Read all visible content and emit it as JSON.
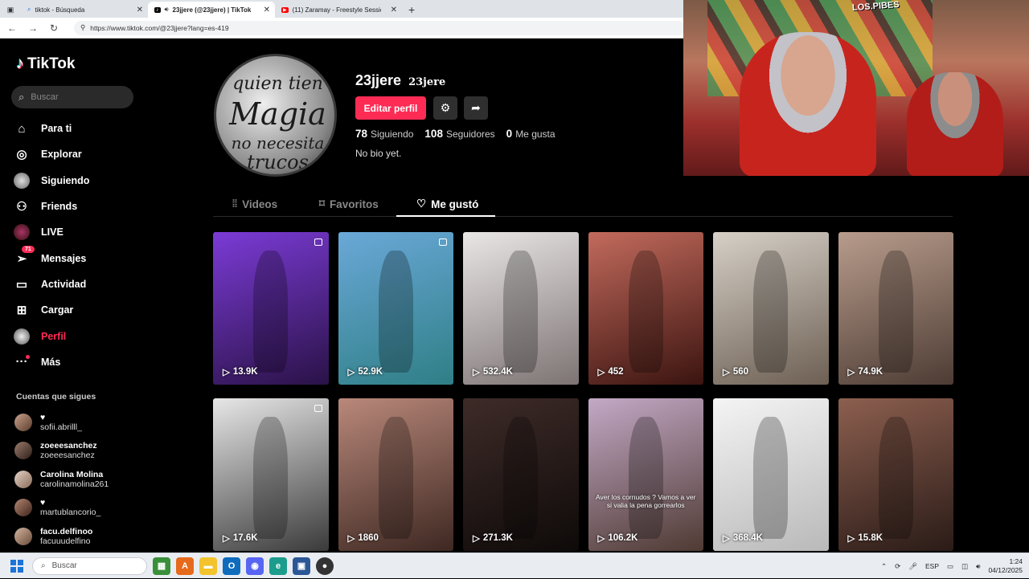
{
  "browser": {
    "tabs": [
      {
        "title": "tiktok - Búsqueda",
        "active": false
      },
      {
        "title": "23jjere (@23jjere) | TikTok",
        "active": true
      },
      {
        "title": "(11) Zaramay - Freestyle Session",
        "active": false
      }
    ],
    "url": "https://www.tiktok.com/@23jjere?lang=es-419"
  },
  "sidebar": {
    "logo_text": "TikTok",
    "search_placeholder": "Buscar",
    "items": [
      {
        "label": "Para ti",
        "icon": "home-icon"
      },
      {
        "label": "Explorar",
        "icon": "compass-icon"
      },
      {
        "label": "Siguiendo",
        "icon": "following-avatar-icon"
      },
      {
        "label": "Friends",
        "icon": "friends-icon"
      },
      {
        "label": "LIVE",
        "icon": "live-avatar-icon"
      },
      {
        "label": "Mensajes",
        "icon": "messages-icon",
        "badge": "71"
      },
      {
        "label": "Actividad",
        "icon": "activity-icon"
      },
      {
        "label": "Cargar",
        "icon": "upload-icon"
      },
      {
        "label": "Perfil",
        "icon": "profile-avatar-icon",
        "active": true
      },
      {
        "label": "Más",
        "icon": "more-icon"
      }
    ],
    "following_title": "Cuentas que sigues",
    "following": [
      {
        "name": "♥",
        "handle": "sofii.abrilll_"
      },
      {
        "name": "zoeeesanchez",
        "handle": "zoeeesanchez"
      },
      {
        "name": "Carolina Molina",
        "handle": "carolinamolina261"
      },
      {
        "name": "♥",
        "handle": "martublancorio_"
      },
      {
        "name": "facu.delfinoo",
        "handle": "facuuudelfino"
      }
    ]
  },
  "profile": {
    "avatar_text": [
      "quien tien",
      "Magia",
      "no necesita",
      "trucos"
    ],
    "username": "23jjere",
    "nickname": "23jere",
    "edit_label": "Editar perfil",
    "stats": [
      {
        "value": "78",
        "label": "Siguiendo"
      },
      {
        "value": "108",
        "label": "Seguidores"
      },
      {
        "value": "0",
        "label": "Me gusta"
      }
    ],
    "bio": "No bio yet."
  },
  "tabs": [
    {
      "label": "Videos",
      "active": false
    },
    {
      "label": "Favoritos",
      "active": false
    },
    {
      "label": "Me gustó",
      "active": true
    }
  ],
  "videos": [
    {
      "views": "13.9K",
      "colors": [
        "#7b3bd6",
        "#2a1247"
      ],
      "multi": true
    },
    {
      "views": "52.9K",
      "colors": [
        "#6aa8d8",
        "#2f7f86"
      ],
      "multi": true
    },
    {
      "views": "532.4K",
      "colors": [
        "#e9e6e6",
        "#7d7373"
      ],
      "multi": false
    },
    {
      "views": "452",
      "colors": [
        "#c26a5c",
        "#3b1410"
      ],
      "multi": false
    },
    {
      "views": "560",
      "colors": [
        "#d6d0c7",
        "#6d5f53"
      ],
      "multi": false
    },
    {
      "views": "74.9K",
      "colors": [
        "#b89c8c",
        "#4d3c34"
      ],
      "multi": false
    },
    {
      "views": "17.6K",
      "colors": [
        "#e7e7e7",
        "#3a3a3a"
      ],
      "multi": true
    },
    {
      "views": "1860",
      "colors": [
        "#b9887a",
        "#3e2822"
      ],
      "multi": false
    },
    {
      "views": "271.3K",
      "colors": [
        "#3e2b28",
        "#0e0a09"
      ],
      "multi": false
    },
    {
      "views": "106.2K",
      "colors": [
        "#c3a9c6",
        "#4f3a33"
      ],
      "multi": false,
      "caption": "Aver los cornudos ? Vamos a ver si valia la pena gorrearlos"
    },
    {
      "views": "368.4K",
      "colors": [
        "#f4f4f4",
        "#b9b9b9"
      ],
      "multi": false
    },
    {
      "views": "15.8K",
      "colors": [
        "#8c5f4f",
        "#2a1b17"
      ],
      "multi": false
    }
  ],
  "webcam": {
    "wall_text": "LOS.PIBES"
  },
  "taskbar": {
    "search_placeholder": "Buscar",
    "language": "ESP",
    "time": "1:24",
    "date": "04/12/2025"
  },
  "colors": {
    "accent": "#fe2c55",
    "background": "#000000"
  }
}
